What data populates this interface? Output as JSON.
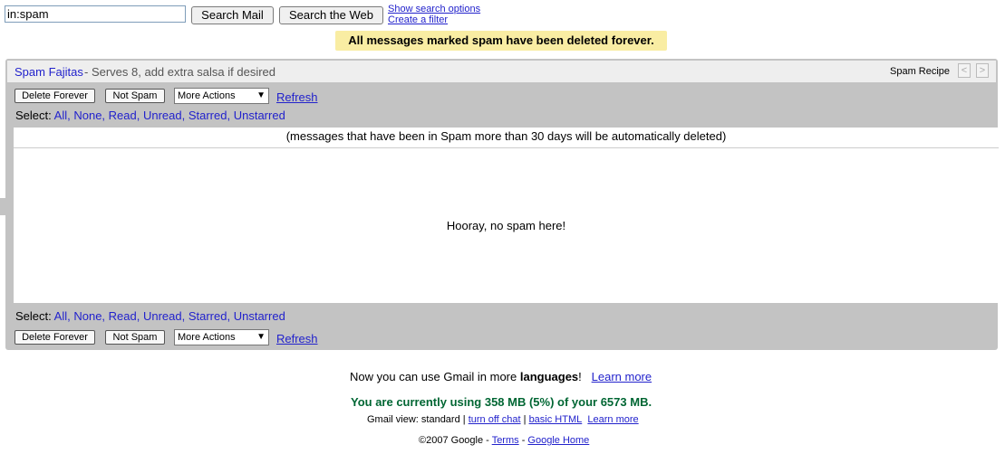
{
  "search": {
    "value": "in:spam",
    "search_mail_label": "Search Mail",
    "search_web_label": "Search the Web",
    "show_options_label": "Show search options",
    "create_filter_label": "Create a filter"
  },
  "notice": "All messages marked spam have been deleted forever.",
  "header": {
    "link_text": "Spam Fajitas",
    "description": "- Serves 8, add extra salsa if desired",
    "recipe_label": "Spam Recipe",
    "prev_arrow": "<",
    "next_arrow": ">"
  },
  "toolbar": {
    "delete_forever": "Delete Forever",
    "not_spam": "Not Spam",
    "more_actions": "More Actions",
    "more_actions_arrow": "▼",
    "refresh": "Refresh"
  },
  "select": {
    "label": "Select:",
    "all": "All",
    "none": "None",
    "read": "Read",
    "unread": "Unread",
    "starred": "Starred",
    "unstarred": "Unstarred"
  },
  "content": {
    "auto_delete_note": "(messages that have been in Spam more than 30 days will be automatically deleted)",
    "empty_message": "Hooray, no spam here!"
  },
  "footer": {
    "languages_prefix": "Now you can use Gmail in more ",
    "languages_bold": "languages",
    "languages_suffix": "!",
    "learn_more": "Learn more",
    "storage": "You are currently using 358 MB (5%) of your 6573 MB.",
    "view_prefix": "Gmail view: standard |",
    "turn_off_chat": "turn off chat",
    "basic_html": "basic HTML",
    "learn_more_2": "Learn more",
    "copyright": "©2007 Google -",
    "terms": "Terms",
    "google_home": "Google Home"
  }
}
